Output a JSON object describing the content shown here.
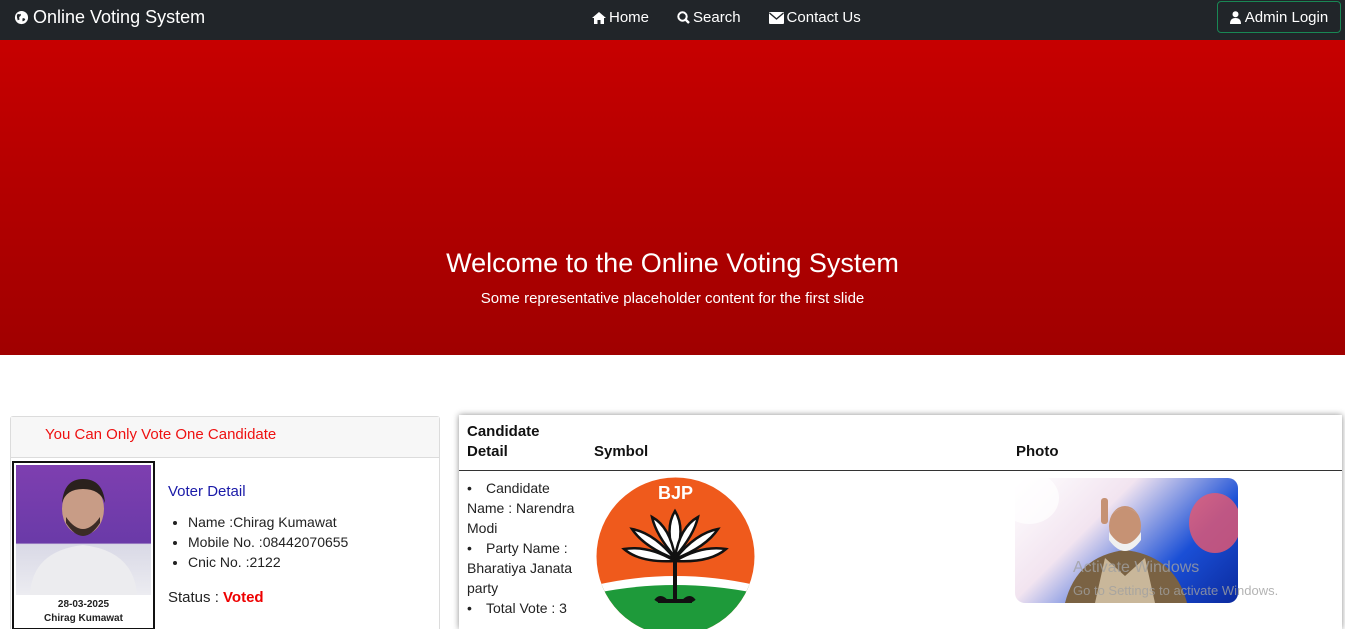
{
  "navbar": {
    "brand": "Online Voting System",
    "brand_icon": "globe-icon",
    "links": [
      {
        "label": "Home",
        "icon": "home-icon"
      },
      {
        "label": "Search",
        "icon": "search-icon"
      },
      {
        "label": "Contact Us",
        "icon": "envelope-icon"
      }
    ],
    "admin_label": "Admin Login",
    "admin_icon": "user-icon"
  },
  "hero": {
    "title": "Welcome to the Online Voting System",
    "subtitle": "Some representative placeholder content for the first slide",
    "color": "#b80000"
  },
  "voter_card": {
    "header": "You Can Only Vote One Candidate",
    "photo_date": "28-03-2025",
    "photo_name": "Chirag Kumawat",
    "title": "Voter Detail",
    "details": [
      "Name :Chirag Kumawat",
      "Mobile No. :08442070655",
      "Cnic No. :2122"
    ],
    "status_label": "Status :",
    "status_value": "Voted"
  },
  "candidates_table": {
    "headers": [
      "Candidate Detail",
      "Symbol",
      "Photo"
    ],
    "rows": [
      {
        "details": [
          "Candidate Name : Narendra Modi",
          "Party Name : Bharatiya Janata party",
          "Total Vote : 3"
        ],
        "symbol_text": "BJP"
      }
    ]
  },
  "watermark": {
    "line1": "Activate Windows",
    "line2": "Go to Settings to activate Windows."
  }
}
